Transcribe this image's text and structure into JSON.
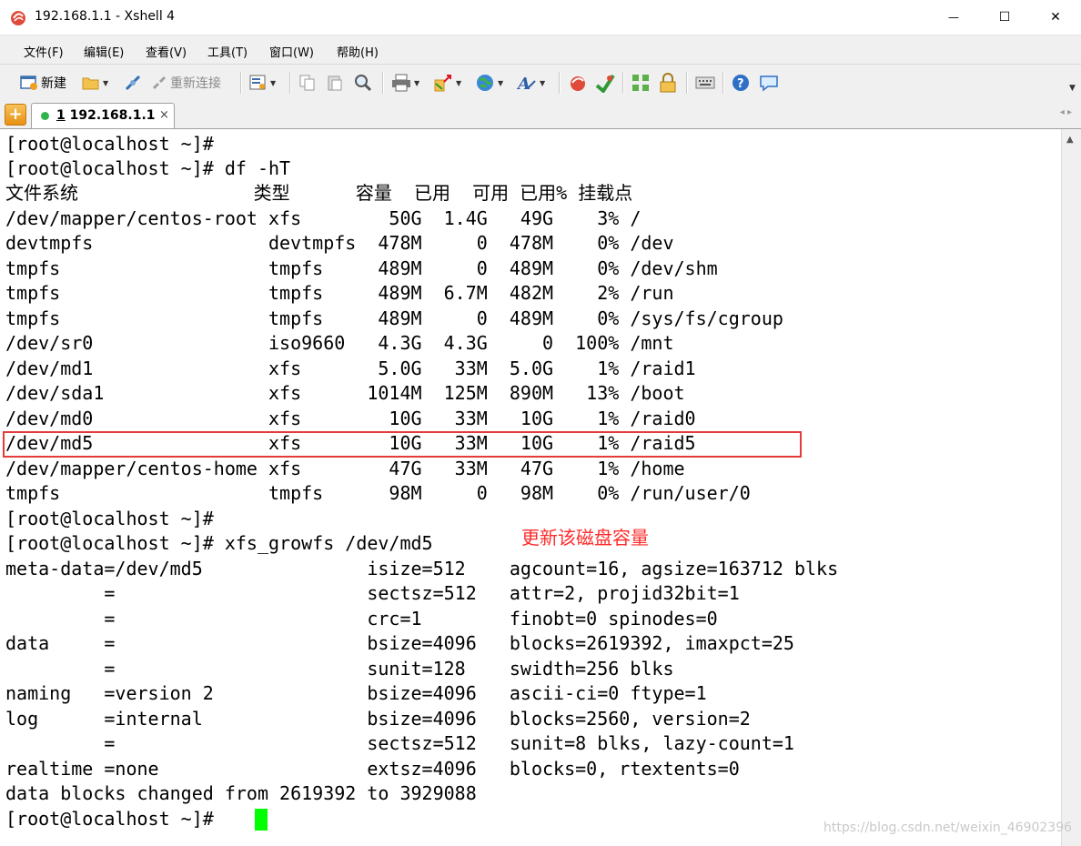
{
  "window": {
    "title": "192.168.1.1 - Xshell 4",
    "minimize_glyph": "—",
    "maximize_glyph": "☐",
    "close_glyph": "✕"
  },
  "menu": {
    "items": [
      "文件(F)",
      "编辑(E)",
      "查看(V)",
      "工具(T)",
      "窗口(W)",
      "帮助(H)"
    ]
  },
  "toolbar": {
    "new_label": "新建",
    "reconnect_label": "重新连接"
  },
  "tabs": {
    "add_glyph": "+",
    "active_number": "1",
    "active_label": "192.168.1.1",
    "close_glyph": "×",
    "nav_arrows": "◂ ▸"
  },
  "terminal": {
    "lines": [
      "[root@localhost ~]#",
      "[root@localhost ~]# df -hT",
      "文件系统                类型      容量  已用  可用 已用% 挂载点",
      "/dev/mapper/centos-root xfs        50G  1.4G   49G    3% /",
      "devtmpfs                devtmpfs  478M     0  478M    0% /dev",
      "tmpfs                   tmpfs     489M     0  489M    0% /dev/shm",
      "tmpfs                   tmpfs     489M  6.7M  482M    2% /run",
      "tmpfs                   tmpfs     489M     0  489M    0% /sys/fs/cgroup",
      "/dev/sr0                iso9660   4.3G  4.3G     0  100% /mnt",
      "/dev/md1                xfs       5.0G   33M  5.0G    1% /raid1",
      "/dev/sda1               xfs      1014M  125M  890M   13% /boot",
      "/dev/md0                xfs        10G   33M   10G    1% /raid0",
      "/dev/md5                xfs        10G   33M   10G    1% /raid5",
      "/dev/mapper/centos-home xfs        47G   33M   47G    1% /home",
      "tmpfs                   tmpfs      98M     0   98M    0% /run/user/0",
      "[root@localhost ~]#",
      "[root@localhost ~]# xfs_growfs /dev/md5",
      "meta-data=/dev/md5               isize=512    agcount=16, agsize=163712 blks",
      "         =                       sectsz=512   attr=2, projid32bit=1",
      "         =                       crc=1        finobt=0 spinodes=0",
      "data     =                       bsize=4096   blocks=2619392, imaxpct=25",
      "         =                       sunit=128    swidth=256 blks",
      "naming   =version 2              bsize=4096   ascii-ci=0 ftype=1",
      "log      =internal               bsize=4096   blocks=2560, version=2",
      "         =                       sectsz=512   sunit=8 blks, lazy-count=1",
      "realtime =none                   extsz=4096   blocks=0, rtextents=0",
      "data blocks changed from 2619392 to 3929088",
      "[root@localhost ~]#"
    ],
    "annotation": "更新该磁盘容量",
    "cursor_color": "#00ff00",
    "highlight_color": "#e53b3b"
  },
  "scrollbar": {
    "up_glyph": "▲"
  },
  "watermark": "https://blog.csdn.net/weixin_46902396"
}
